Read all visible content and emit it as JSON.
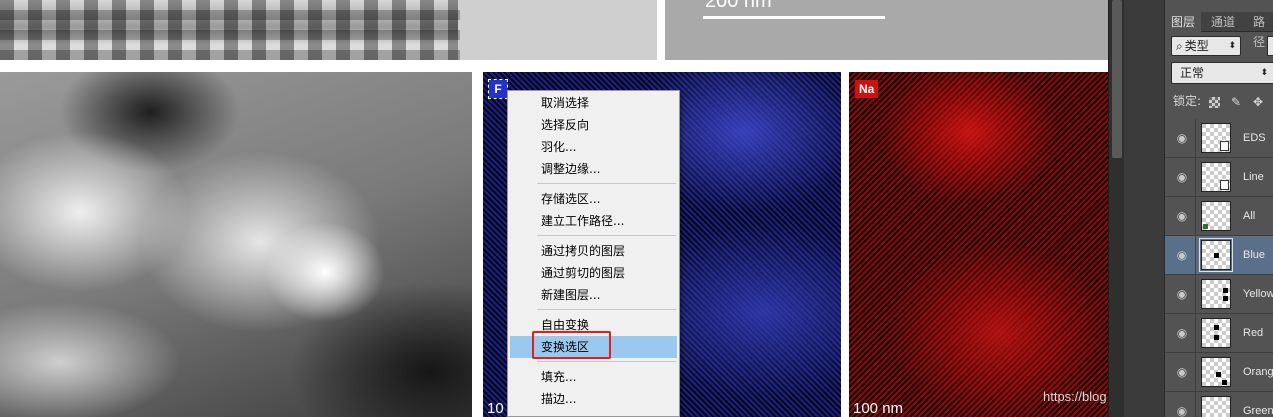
{
  "canvas": {
    "top_scalebar_label": "200 nm",
    "blue_map": {
      "element": "F",
      "scale_label": "10",
      "color": "#2233cc"
    },
    "red_map": {
      "element": "Na",
      "scale_label": "100 nm",
      "color": "#cc1111"
    }
  },
  "context_menu": {
    "items": [
      {
        "label": "取消选择"
      },
      {
        "label": "选择反向"
      },
      {
        "label": "羽化..."
      },
      {
        "label": "调整边缘..."
      },
      {
        "label": "存储选区..."
      },
      {
        "label": "建立工作路径..."
      },
      {
        "label": "通过拷贝的图层"
      },
      {
        "label": "通过剪切的图层"
      },
      {
        "label": "新建图层..."
      },
      {
        "label": "自由变换"
      },
      {
        "label": "变换选区",
        "highlighted": true
      },
      {
        "label": "填充..."
      },
      {
        "label": "描边..."
      }
    ],
    "highlight_color": "#99c9ef",
    "annotation_box_color": "#e02020"
  },
  "layers_panel": {
    "tabs": [
      "图层",
      "通道",
      "路径"
    ],
    "filter": {
      "icon": "search-icon",
      "label": "类型"
    },
    "blend_mode": "正常",
    "lock_label": "锁定:",
    "layers": [
      {
        "name": "EDS",
        "visible": true,
        "selected": false
      },
      {
        "name": "Line",
        "visible": true,
        "selected": false
      },
      {
        "name": "All",
        "visible": true,
        "selected": false
      },
      {
        "name": "Blue",
        "visible": true,
        "selected": true
      },
      {
        "name": "Yellow",
        "visible": true,
        "selected": false
      },
      {
        "name": "Red",
        "visible": true,
        "selected": false
      },
      {
        "name": "Orange",
        "visible": true,
        "selected": false
      },
      {
        "name": "Green",
        "visible": true,
        "selected": false
      }
    ],
    "selected_color": "#5a6f8a"
  },
  "watermark": "https://blog.csdn.net/XiaoWangf"
}
